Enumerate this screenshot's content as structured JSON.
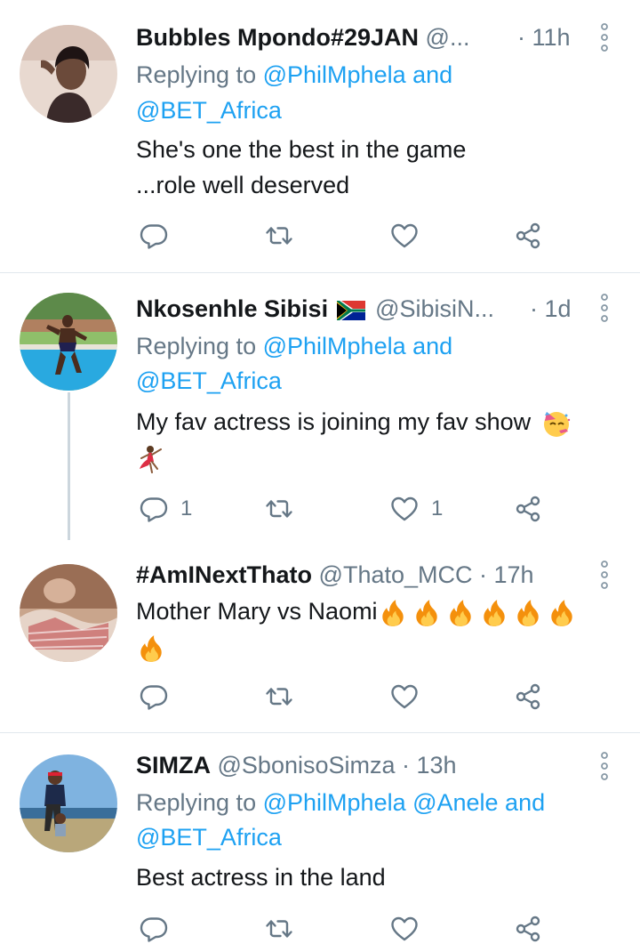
{
  "tweets": [
    {
      "name": "Bubbles Mpondo#29JAN",
      "handle": "@...",
      "time": "· 11h",
      "replying_prefix": "Replying to",
      "replying_line1": "@PhilMphela and",
      "replying_line2": "@BET_Africa",
      "text_line1": "She's one the best in the game",
      "text_line2": "...role well deserved",
      "reply_count": "",
      "like_count": ""
    },
    {
      "name": "Nkosenhle Sibisi",
      "handle": "@SibisiN...",
      "time": "· 1d",
      "replying_prefix": "Replying to",
      "replying_line1": "@PhilMphela and",
      "replying_line2": "@BET_Africa",
      "text_line1": "My fav actress is joining my fav show",
      "reply_count": "1",
      "like_count": "1"
    },
    {
      "name": "#AmINextThato",
      "handle": "@Thato_MCC",
      "time": "· 17h",
      "text_line1": "Mother Mary vs Naomi"
    },
    {
      "name": "SIMZA",
      "handle": "@SbonisoSimza",
      "time": "· 13h",
      "replying_prefix": "Replying to",
      "replying_line1": "@PhilMphela @Anele and",
      "replying_line2": "@BET_Africa",
      "text_line1": "Best actress in the land"
    }
  ],
  "icons": {
    "reply": "reply-icon",
    "retweet": "retweet-icon",
    "like": "like-icon",
    "share": "share-icon",
    "more": "more-icon"
  },
  "colors": {
    "link": "#1da1f2",
    "muted": "#657786",
    "text": "#14171a",
    "divider": "#e1e8ed"
  }
}
